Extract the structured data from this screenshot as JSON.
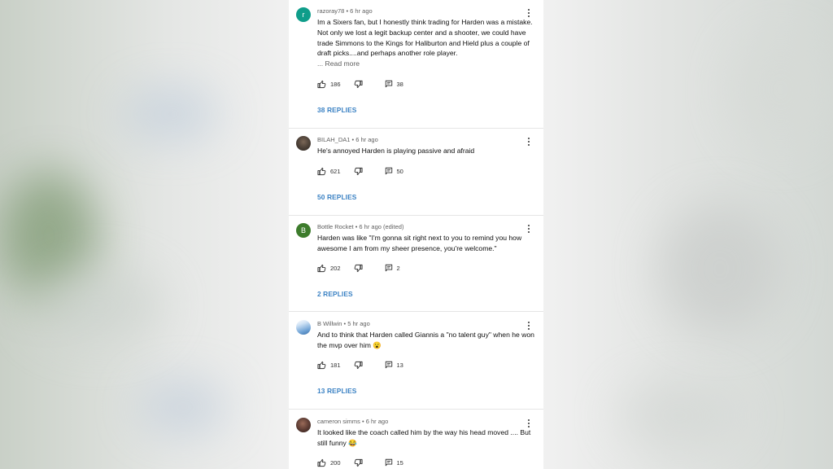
{
  "comments": [
    {
      "author": "razoray78",
      "time": "6 hr ago",
      "text": "Im a Sixers fan, but I honestly think trading for Harden was a mistake. Not only we lost a legit backup center and a shooter, we could have trade Simmons to the Kings for Haliburton and Hield plus a couple of draft picks....and perhaps another role player.",
      "read_more": "... Read more",
      "avatar_letter": "r",
      "avatar_color": "#0f9d8a",
      "likes": "186",
      "reply_count": "38",
      "replies_label": "38 REPLIES"
    },
    {
      "author": "BILAH_DA1",
      "time": "6 hr ago",
      "text": "He's annoyed Harden is playing passive and afraid",
      "read_more": "",
      "avatar_letter": "",
      "avatar_color": "#4a3f36",
      "likes": "621",
      "reply_count": "50",
      "replies_label": "50 REPLIES"
    },
    {
      "author": "Bottle Rocket",
      "time": "6 hr ago (edited)",
      "text": "Harden was like \"I'm gonna sit right next to you to remind you how awesome I am from my sheer presence, you're welcome.\"",
      "read_more": "",
      "avatar_letter": "B",
      "avatar_color": "#3d7c2c",
      "likes": "202",
      "reply_count": "2",
      "replies_label": "2 REPLIES"
    },
    {
      "author": "B Willwin",
      "time": "5 hr ago",
      "text": "And to think that Harden called Giannis a \"no talent guy\" when he won the mvp over him 😮",
      "read_more": "",
      "avatar_letter": "",
      "avatar_color": "#a9c8e8",
      "likes": "181",
      "reply_count": "13",
      "replies_label": "13 REPLIES"
    },
    {
      "author": "cameron simms",
      "time": "6 hr ago",
      "text": "It looked like the coach called him by the way his head moved .... But still funny 😂",
      "read_more": "",
      "avatar_letter": "",
      "avatar_color": "#5a3a32",
      "likes": "200",
      "reply_count": "15",
      "replies_label": ""
    }
  ],
  "icons": {
    "like": "thumbs-up-icon",
    "dislike": "thumbs-down-icon",
    "reply": "comment-reply-icon",
    "menu": "more-vertical-icon"
  }
}
